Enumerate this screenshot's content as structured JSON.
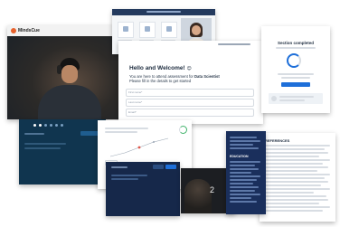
{
  "welcome": {
    "title": "Hello and Welcome!",
    "emoji": "😊",
    "line1_prefix": "You are here to attend assessment for ",
    "line1_role": "Data Scientist",
    "line2": "Please fill in the details to get started",
    "first_name_placeholder": "First name*",
    "last_name_placeholder": "Last name*",
    "email_placeholder": "Email*"
  },
  "brand": {
    "name": "MindsCue"
  },
  "section_complete": {
    "title": "Section completed"
  },
  "references": {
    "heading": "REFERENCES",
    "education_heading": "EDUCATION"
  },
  "video": {
    "label": "2"
  },
  "colors": {
    "brand_orange": "#e8622c",
    "accent_blue": "#1e6fd9",
    "navy": "#16284a",
    "dark_teal": "#10354f"
  }
}
